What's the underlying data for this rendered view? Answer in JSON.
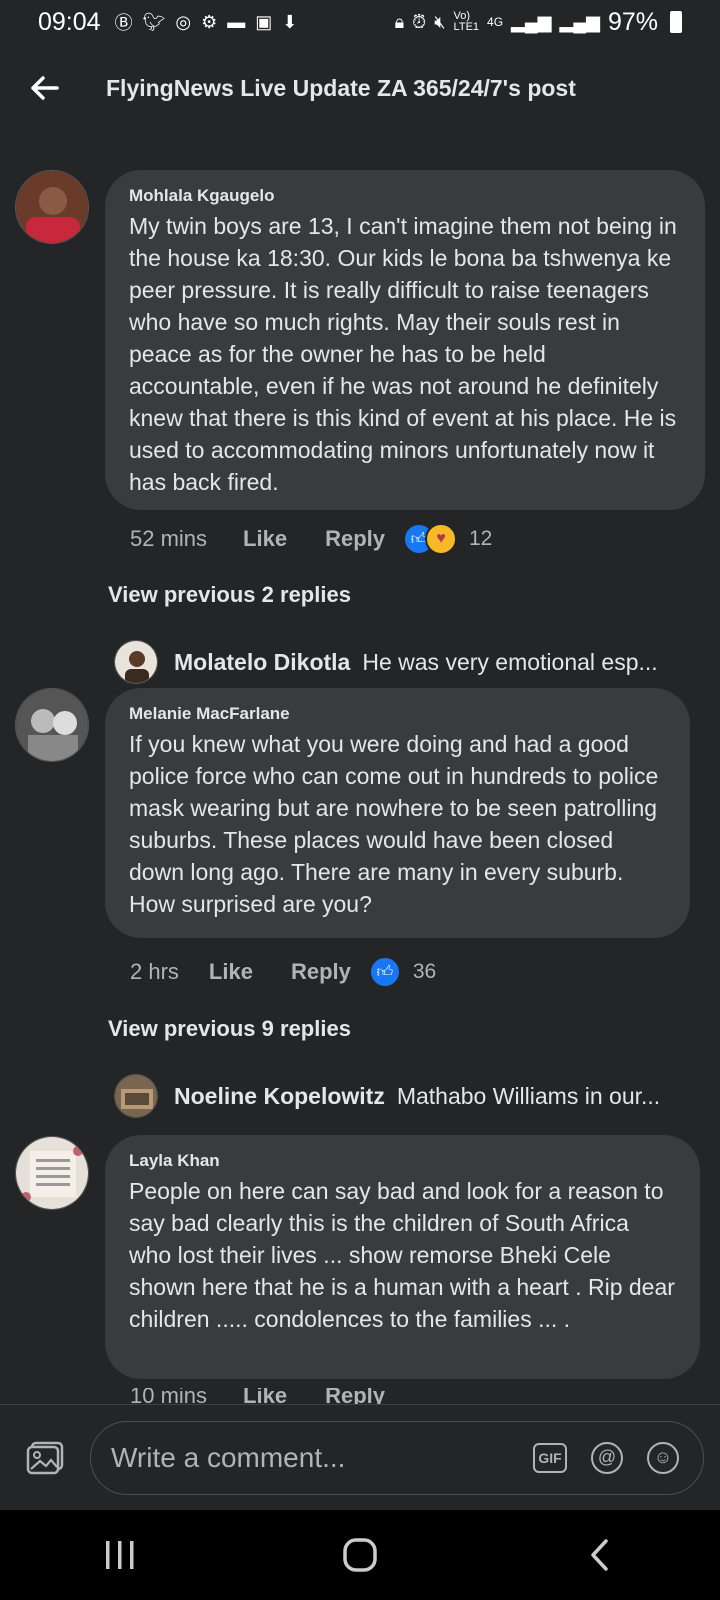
{
  "status_bar": {
    "time": "09:04",
    "battery": "97%",
    "left_icons": [
      "b-icon",
      "twitter-icon",
      "chrome-icon",
      "gear-icon",
      "car-icon",
      "image-icon",
      "download-icon"
    ],
    "right_icons": [
      "lock-icon",
      "alarm-icon",
      "mute-icon",
      "volte-icon",
      "4g-icon",
      "signal-icon",
      "signal-icon"
    ]
  },
  "header": {
    "title": "FlyingNews Live Update ZA 365/24/7's post"
  },
  "comments": [
    {
      "author": "Mohlala Kgaugelo",
      "text": "My twin boys are 13, I can't imagine them not being in the house ka 18:30. Our kids le bona ba tshwenya ke peer pressure. It is really difficult to raise teenagers who have so much rights. May their souls rest in peace as for the owner he has to be held accountable, even if he was not around he definitely knew that there is this kind of event at his place. He is used to accommodating minors unfortunately now it has back fired.",
      "time": "52 mins",
      "like": "Like",
      "reply": "Reply",
      "reaction_count": "12",
      "view_previous": "View previous 2 replies",
      "reply_preview": {
        "name": "Molatelo Dikotla",
        "text": "He was very emotional esp..."
      }
    },
    {
      "author": "Melanie MacFarlane",
      "text": "If you knew what you were doing and had a good police force who can come out in hundreds to police mask wearing but are nowhere to be seen patrolling suburbs.  These places would have been closed down long ago. There are many in every suburb. How surprised are you?",
      "time": "2 hrs",
      "like": "Like",
      "reply": "Reply",
      "reaction_count": "36",
      "view_previous": "View previous 9 replies",
      "reply_preview": {
        "name": "Noeline Kopelowitz",
        "text": "Mathabo Williams  in our..."
      }
    },
    {
      "author": "Layla Khan",
      "text": "People on here can say bad and look for a reason to say bad clearly this is the children of South Africa who lost their lives ... show remorse Bheki Cele shown here that he is a human with a heart . Rip dear children ..... condolences to the families ... .",
      "time": "10 mins",
      "like": "Like",
      "reply": "Reply"
    }
  ],
  "composer": {
    "placeholder": "Write a comment...",
    "gif_label": "GIF"
  },
  "colors": {
    "background": "#242526",
    "bubble": "#3a3b3c",
    "like_blue": "#1877f2"
  }
}
